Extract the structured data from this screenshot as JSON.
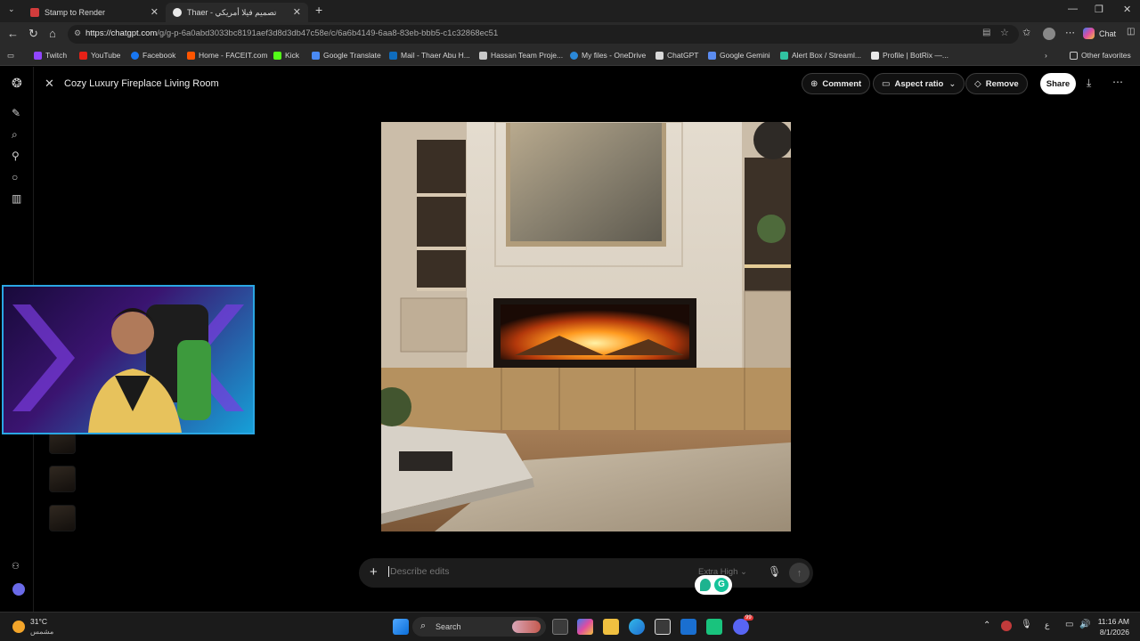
{
  "browser": {
    "tabs": [
      {
        "label": "Stamp to Render",
        "active": false
      },
      {
        "label": "Thaer - تصميم فيلا أمريكي",
        "active": true
      }
    ],
    "url_domain": "https://chatgpt.com",
    "url_path": "/g/g-p-6a0abd3033bc8191aef3d8d3db47c58e/c/6a6b4149-6aa8-83eb-bbb5-c1c32868ec51",
    "chat_label": "Chat",
    "bookmarks": [
      "Twitch",
      "YouTube",
      "Facebook",
      "Home - FACEIT.com",
      "Kick",
      "Google Translate",
      "Mail - Thaer Abu H...",
      "Hassan Team Proje...",
      "My files - OneDrive",
      "ChatGPT",
      "Google Gemini",
      "Alert Box / Streaml...",
      "Profile | BotRix —...",
      "Other favorites"
    ]
  },
  "editor": {
    "title": "Cozy Luxury Fireplace Living Room",
    "comment_label": "Comment",
    "aspect_label": "Aspect ratio",
    "remove_label": "Remove",
    "share_label": "Share",
    "prompt_placeholder": "Describe edits",
    "quality_label": "Extra High"
  },
  "taskbar": {
    "weather_temp": "31°C",
    "weather_desc": "مشمس",
    "search_label": "Search",
    "lang": "ع",
    "time": "11:16 AM",
    "date": "8/1/2026",
    "badge": "99"
  },
  "icons": {
    "close": "close-icon",
    "mic": "mic-icon",
    "send": "send-arrow-icon",
    "download": "download-icon",
    "more": "more-icon"
  }
}
